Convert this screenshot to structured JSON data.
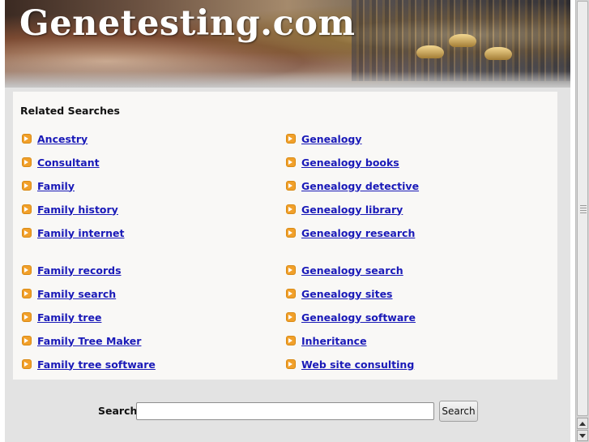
{
  "header": {
    "site_title": "Genetesting.com"
  },
  "related": {
    "heading": "Related Searches",
    "left_column": [
      "Ancestry",
      "Consultant",
      "Family",
      "Family history",
      "Family internet",
      "Family records",
      "Family search",
      "Family tree",
      "Family Tree Maker",
      "Family tree software"
    ],
    "right_column": [
      "Genealogy",
      "Genealogy books",
      "Genealogy detective",
      "Genealogy library",
      "Genealogy research",
      "Genealogy search",
      "Genealogy sites",
      "Genealogy software",
      "Inheritance",
      "Web site consulting"
    ]
  },
  "search": {
    "label": "Search",
    "input_value": "",
    "button_label": "Search"
  },
  "colors": {
    "link": "#1a1ab8",
    "bullet": "#f1a02a",
    "panel": "#f9f8f6",
    "frame": "#e3e3e3"
  },
  "icons": {
    "bullet": "orange-arrow-bullet-icon"
  }
}
